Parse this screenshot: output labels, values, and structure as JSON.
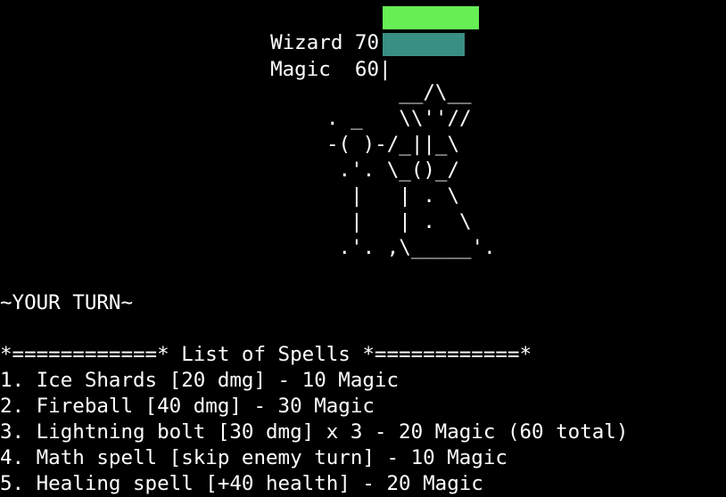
{
  "stats": {
    "wizard": {
      "label": "Wizard",
      "value": "70",
      "separator": "|",
      "level": 70,
      "color": "#66ee55"
    },
    "magic": {
      "label": "Magic",
      "value": "60",
      "separator": "|",
      "level": 60,
      "color": "#3a8f84"
    }
  },
  "ascii_art": "      __/\\__\n. _   \\\\''//\n-( )-/_||_\\\n .'. \\_()_/\n  |   | . \\\n  |   | .  \\\n .'. ,\\_____'.",
  "turn_banner": "~YOUR TURN~",
  "spell_list": {
    "header": "*============* List of Spells *============*",
    "items": [
      "1. Ice Shards [20 dmg] - 10 Magic",
      "2. Fireball [40 dmg] - 30 Magic",
      "3. Lightning bolt [30 dmg] x 3 - 20 Magic (60 total)",
      "4. Math spell [skip enemy turn] - 10 Magic",
      "5. Healing spell [+40 health] - 20 Magic"
    ]
  }
}
